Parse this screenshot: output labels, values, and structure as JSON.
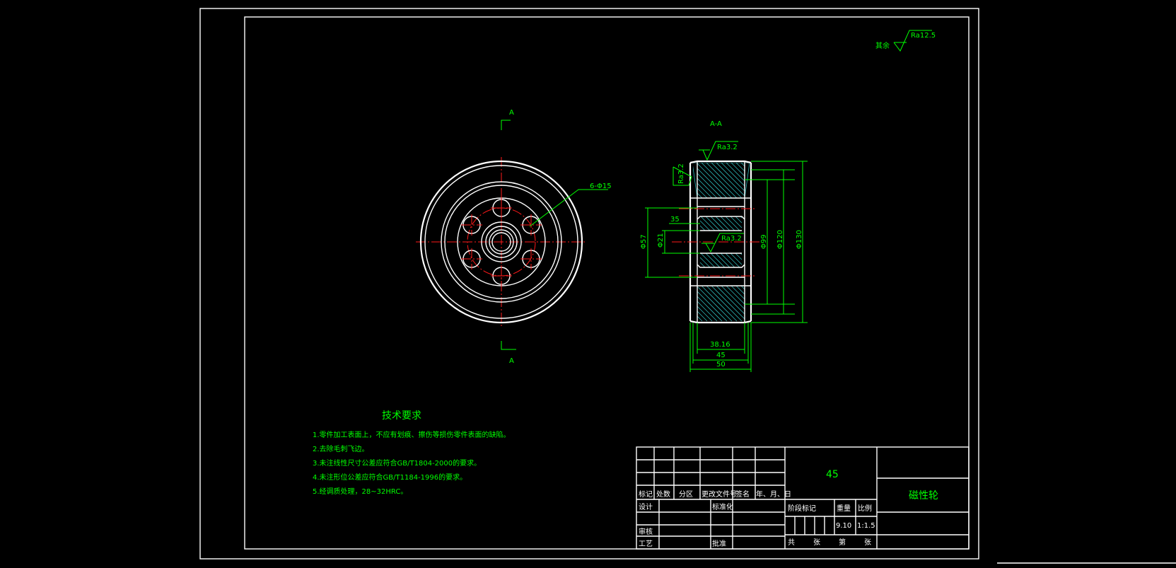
{
  "drawing": {
    "surface_roughness_note_prefix": "其余",
    "surface_roughness_note_value": "Ra12.5",
    "section_label_top": "A",
    "section_label_bottom": "A",
    "section_view_title": "A-A"
  },
  "front_view": {
    "hole_callout": "6-Φ15"
  },
  "section_view": {
    "roughness_labels": [
      "Ra3.2",
      "Ra3.2",
      "Ra3.2"
    ],
    "dims": {
      "d57": "Φ57",
      "d21": "Φ21",
      "l35": "35",
      "d99": "Φ99",
      "d120": "Φ120",
      "d130": "Φ130",
      "w3816": "38.16",
      "w45": "45",
      "w50": "50"
    }
  },
  "tech_requirements": {
    "title": "技术要求",
    "items": [
      "1.零件加工表面上，不应有划痕、擦伤等损伤零件表面的缺陷。",
      "2.去除毛刺飞边。",
      "3.未注线性尺寸公差应符合GB/T1804-2000的要求。",
      "4.未注形位公差应符合GB/T1184-1996的要求。",
      "5.经调质处理，28~32HRC。"
    ]
  },
  "title_block": {
    "material": "45",
    "part_name": "磁性轮",
    "headers": [
      "标记",
      "处数",
      "分区",
      "更改文件号",
      "签名",
      "年、月、日"
    ],
    "design": "设计",
    "standardize": "标准化",
    "review": "审核",
    "process": "工艺",
    "approve": "批准",
    "stage_mark": "阶段标记",
    "weight": "重量",
    "scale": "比例",
    "weight_value": "9.10",
    "scale_value": "1:1.5",
    "sheets_total": "共",
    "sheets_unit1": "张",
    "sheet_no": "第",
    "sheets_unit2": "张"
  }
}
